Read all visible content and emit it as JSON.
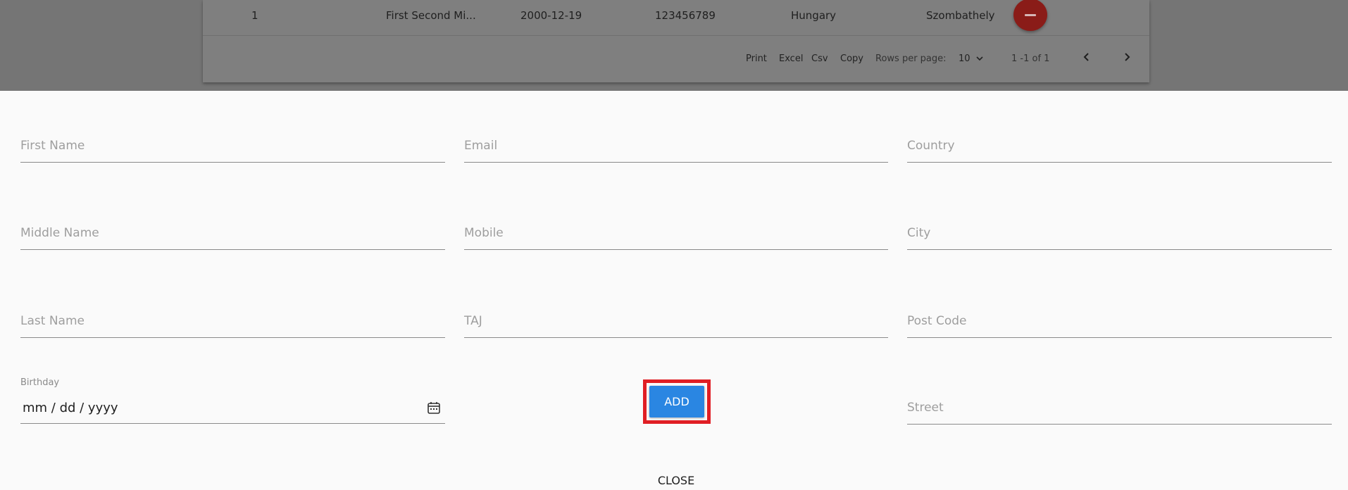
{
  "table": {
    "row": {
      "index": "1",
      "name": "First Second Mi...",
      "birthday": "2000-12-19",
      "taj": "123456789",
      "country": "Hungary",
      "city": "Szombathely"
    },
    "footer": {
      "print": "Print",
      "excel": "Excel",
      "csv": "Csv",
      "copy": "Copy",
      "rows_per_page_label": "Rows per page:",
      "rows_per_page_value": "10",
      "pagination_info": "1 -1 of 1"
    }
  },
  "form": {
    "first_name": {
      "placeholder": "First Name",
      "value": ""
    },
    "middle_name": {
      "placeholder": "Middle Name",
      "value": ""
    },
    "last_name": {
      "placeholder": "Last Name",
      "value": ""
    },
    "email": {
      "placeholder": "Email",
      "value": ""
    },
    "mobile": {
      "placeholder": "Mobile",
      "value": ""
    },
    "taj": {
      "placeholder": "TAJ",
      "value": ""
    },
    "country": {
      "placeholder": "Country",
      "value": ""
    },
    "city": {
      "placeholder": "City",
      "value": ""
    },
    "post_code": {
      "placeholder": "Post Code",
      "value": ""
    },
    "street": {
      "placeholder": "Street",
      "value": ""
    },
    "birthday": {
      "label": "Birthday",
      "value": "mm / dd / yyyy"
    },
    "add_label": "ADD",
    "close_label": "CLOSE"
  },
  "colors": {
    "primary": "#2a86e2",
    "highlight": "#e01e24",
    "danger": "#8a1c18"
  }
}
